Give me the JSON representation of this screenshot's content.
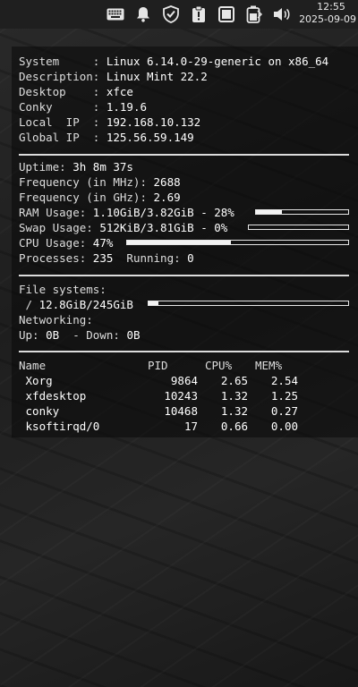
{
  "panel": {
    "tray_icons": [
      "keyboard-icon",
      "notification-bell-icon",
      "shield-icon",
      "clipboard-icon",
      "window-icon",
      "battery-icon",
      "volume-icon"
    ],
    "time": "12:55",
    "date": "2025-09-09"
  },
  "conky": {
    "system": {
      "system_label": "System     :",
      "system_value": "Linux 6.14.0-29-generic on x86_64",
      "description_label": "Description:",
      "description_value": "Linux Mint 22.2",
      "desktop_label": "Desktop    :",
      "desktop_value": "xfce",
      "conky_label": "Conky      :",
      "conky_value": "1.19.6",
      "local_ip_label": "Local  IP  :",
      "local_ip_value": "192.168.10.132",
      "global_ip_label": "Global IP  :",
      "global_ip_value": "125.56.59.149"
    },
    "stats": {
      "uptime_label": "Uptime: ",
      "uptime_value": "3h 8m 37s",
      "freq_mhz_label": "Frequency (in MHz): ",
      "freq_mhz_value": "2688",
      "freq_ghz_label": "Frequency (in GHz): ",
      "freq_ghz_value": "2.69",
      "ram_label": "RAM Usage: ",
      "ram_value": "1.10GiB/3.82GiB - 28%",
      "ram_percent": 28,
      "swap_label": "Swap Usage: ",
      "swap_value": "512KiB/3.81GiB - 0%",
      "swap_percent": 0,
      "cpu_label": "CPU Usage: ",
      "cpu_value": "47%",
      "cpu_percent": 47,
      "processes_label": "Processes: ",
      "processes_value": "235",
      "running_label": "  Running: ",
      "running_value": "0"
    },
    "fs": {
      "filesystems_label": "File systems:",
      "root_label": " / ",
      "root_value": "12.8GiB/245GiB",
      "root_percent": 5,
      "networking_label": "Networking:",
      "up_label": "Up: ",
      "up_value": "0B",
      "down_label": "  - Down: ",
      "down_value": "0B"
    },
    "processes": {
      "headers": [
        "Name",
        "PID",
        "CPU%",
        "MEM%"
      ],
      "rows": [
        {
          "name": " Xorg",
          "pid": "9864",
          "cpu": "2.65",
          "mem": "2.54"
        },
        {
          "name": " xfdesktop",
          "pid": "10243",
          "cpu": "1.32",
          "mem": "1.25"
        },
        {
          "name": " conky",
          "pid": "10468",
          "cpu": "1.32",
          "mem": "0.27"
        },
        {
          "name": " ksoftirqd/0",
          "pid": "17",
          "cpu": "0.66",
          "mem": "0.00"
        }
      ]
    }
  }
}
